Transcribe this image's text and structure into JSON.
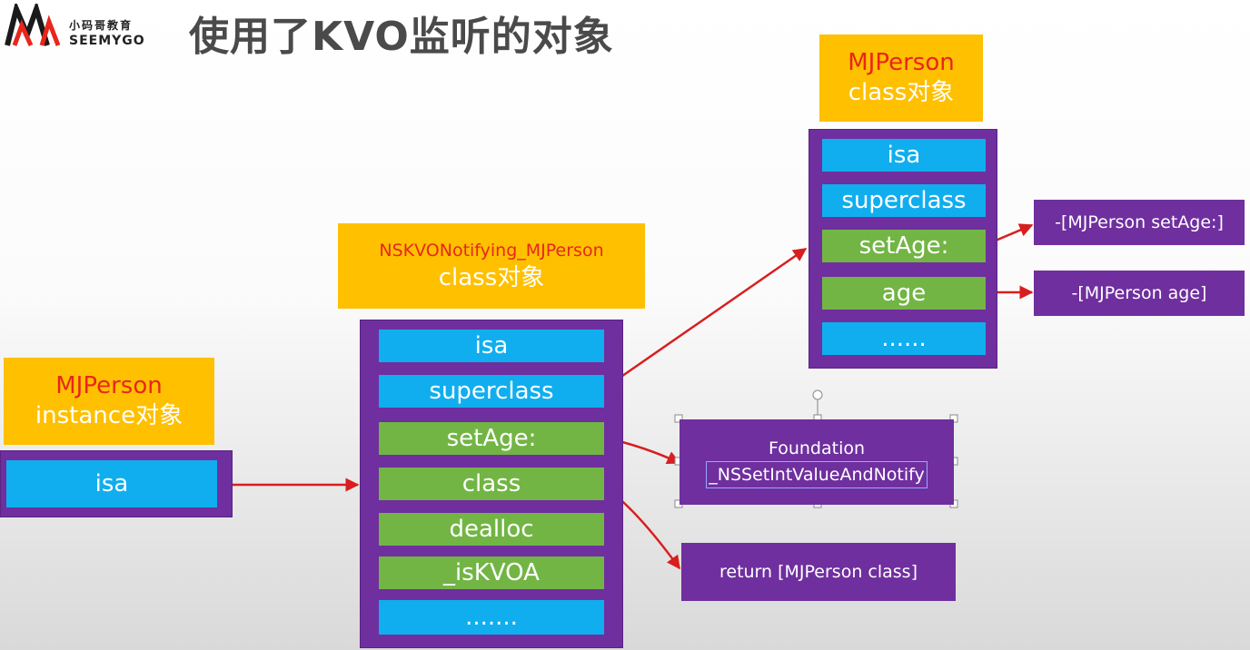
{
  "header": {
    "logo_cn": "小码哥教育",
    "logo_en": "SEEMYGO",
    "title": "使用了KVO监听的对象"
  },
  "instance": {
    "name": "MJPerson",
    "subtitle": "instance对象",
    "slots": [
      "isa"
    ]
  },
  "kvo_class": {
    "name": "NSKVONotifying_MJPerson",
    "subtitle": "class对象",
    "slots": [
      "isa",
      "superclass",
      "setAge:",
      "class",
      "dealloc",
      "_isKVOA",
      "......."
    ]
  },
  "person_class": {
    "name": "MJPerson",
    "subtitle": "class对象",
    "slots": [
      "isa",
      "superclass",
      "setAge:",
      "age",
      "......"
    ]
  },
  "methods": {
    "set_age_impl": "-[MJPerson setAge:]",
    "age_impl": "-[MJPerson age]",
    "foundation_title": "Foundation",
    "foundation_func": "_NSSetIntValueAndNotify",
    "class_impl": "return [MJPerson class]"
  },
  "colors": {
    "label_bg": "#ffc000",
    "label_name": "#e8261b",
    "container": "#6f2f9f",
    "slot_blue": "#10aeef",
    "slot_green": "#72b544",
    "arrow": "#d81e1e"
  }
}
